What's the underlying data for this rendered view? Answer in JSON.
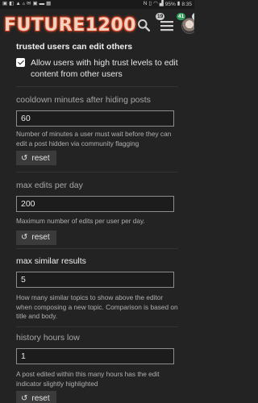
{
  "status_bar": {
    "left_icons": [
      "▣",
      "◧",
      "▲",
      "▵",
      "✉",
      "▣",
      "▬",
      "▦"
    ],
    "battery": "95%",
    "time": "8:35"
  },
  "header": {
    "logo_text": "FUTURE1200",
    "search_icon": "search-icon",
    "menu_badge": "19",
    "menu_badge_green": "41",
    "avatar_badge": "1"
  },
  "settings": {
    "trusted": {
      "title": "trusted users can edit others",
      "checkbox_label": "Allow users with high trust levels to edit content from other users",
      "checked": true
    },
    "cooldown": {
      "title": "cooldown minutes after hiding posts",
      "value": "60",
      "description": "Number of minutes a user must wait before they can edit a post hidden via community flagging",
      "reset_label": "reset"
    },
    "max_edits": {
      "title": "max edits per day",
      "value": "200",
      "description": "Maximum number of edits per user per day.",
      "reset_label": "reset"
    },
    "max_similar": {
      "title": "max similar results",
      "value": "5",
      "description": "How many similar topics to show above the editor when composing a new topic. Comparison is based on title and body."
    },
    "history": {
      "title": "history hours low",
      "value": "1",
      "description": "A post edited within this many hours has the edit indicator slightly highlighted",
      "reset_label": "reset"
    }
  }
}
